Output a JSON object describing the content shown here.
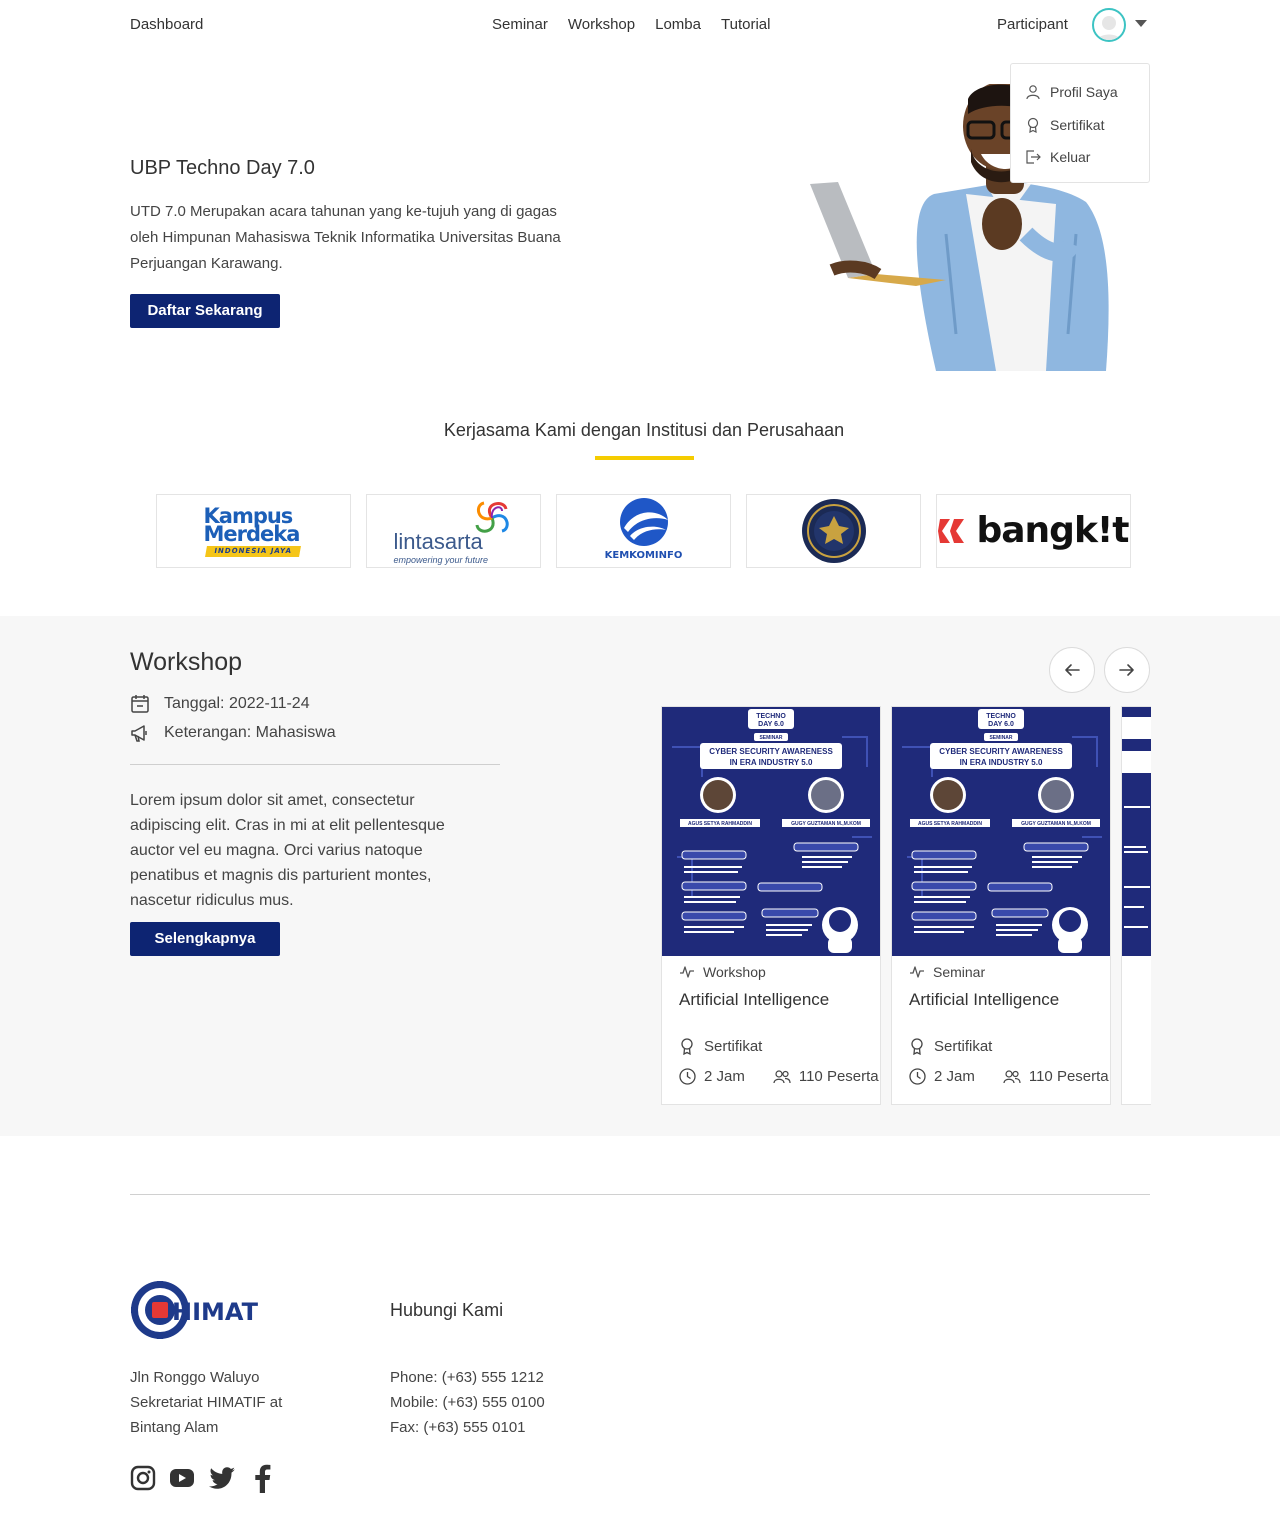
{
  "nav": {
    "brand": "Dashboard",
    "links": [
      "Seminar",
      "Workshop",
      "Lomba",
      "Tutorial"
    ],
    "user_label": "Participant"
  },
  "dropdown": {
    "items": [
      "Profil Saya",
      "Sertifikat",
      "Keluar"
    ]
  },
  "hero": {
    "title": "UBP Techno Day 7.0",
    "description": "UTD 7.0 Merupakan acara tahunan yang ke-tujuh yang di gagas oleh Himpunan Mahasiswa Teknik Informatika Universitas Buana Perjuangan Karawang.",
    "cta": "Daftar Sekarang"
  },
  "partners": {
    "title": "Kerjasama Kami dengan Institusi dan Perusahaan",
    "accent_color": "#f5cc00",
    "logos": [
      {
        "line1": "Kampus",
        "line2": "Merdeka",
        "tag": "INDONESIA JAYA"
      },
      {
        "name": "lintasarta",
        "tag": "empowering your future"
      },
      {
        "name": "KEMKOMINFO"
      },
      {
        "name": "REPUBLIK INDONESIA"
      },
      {
        "name": "bangk!t"
      }
    ]
  },
  "workshop": {
    "title": "Workshop",
    "date": "Tanggal: 2022-11-24",
    "note": "Keterangan: Mahasiswa",
    "description": "Lorem ipsum dolor sit amet, consectetur adipiscing elit. Cras in mi at elit pellentesque auctor vel eu magna. Orci varius natoque penatibus et magnis dis parturient montes, nascetur ridiculus mus.",
    "cta": "Selengkapnya",
    "cards": [
      {
        "category": "Workshop",
        "title": "Artificial Intelligence",
        "cert": "Sertifikat",
        "duration": "2 Jam",
        "participants": "110 Peserta",
        "poster": {
          "top": "TECHNO",
          "day": "DAY 6.0",
          "tag": "SEMINAR",
          "headline1": "CYBER SECURITY AWARENESS",
          "headline2": "IN ERA INDUSTRY 5.0",
          "speaker1": "AGUS SETYA RAHMADDIN",
          "speaker2": "GUGY GUZTAMAN M.,M.KOM"
        }
      },
      {
        "category": "Seminar",
        "title": "Artificial Intelligence",
        "cert": "Sertifikat",
        "duration": "2 Jam",
        "participants": "110 Peserta",
        "poster": {
          "top": "TECHNO",
          "day": "DAY 6.0",
          "tag": "SEMINAR",
          "headline1": "CYBER SECURITY AWARENESS",
          "headline2": "IN ERA INDUSTRY 5.0",
          "speaker1": "AGUS SETYA RAHMADDIN",
          "speaker2": "GUGY GUZTAMAN M.,M.KOM"
        }
      }
    ]
  },
  "footer": {
    "logo_text": "HIMATIF",
    "address": [
      "Jln Ronggo Waluyo",
      "Sekretariat HIMATIF at",
      "Bintang Alam"
    ],
    "contact_title": "Hubungi Kami",
    "contacts": [
      "Phone: (+63) 555 1212",
      "Mobile: (+63) 555 0100",
      "Fax: (+63) 555 0101"
    ]
  },
  "colors": {
    "primary": "#0d2472",
    "avatar_ring": "#3cc3c3",
    "section_bg": "#f7f7f7"
  }
}
